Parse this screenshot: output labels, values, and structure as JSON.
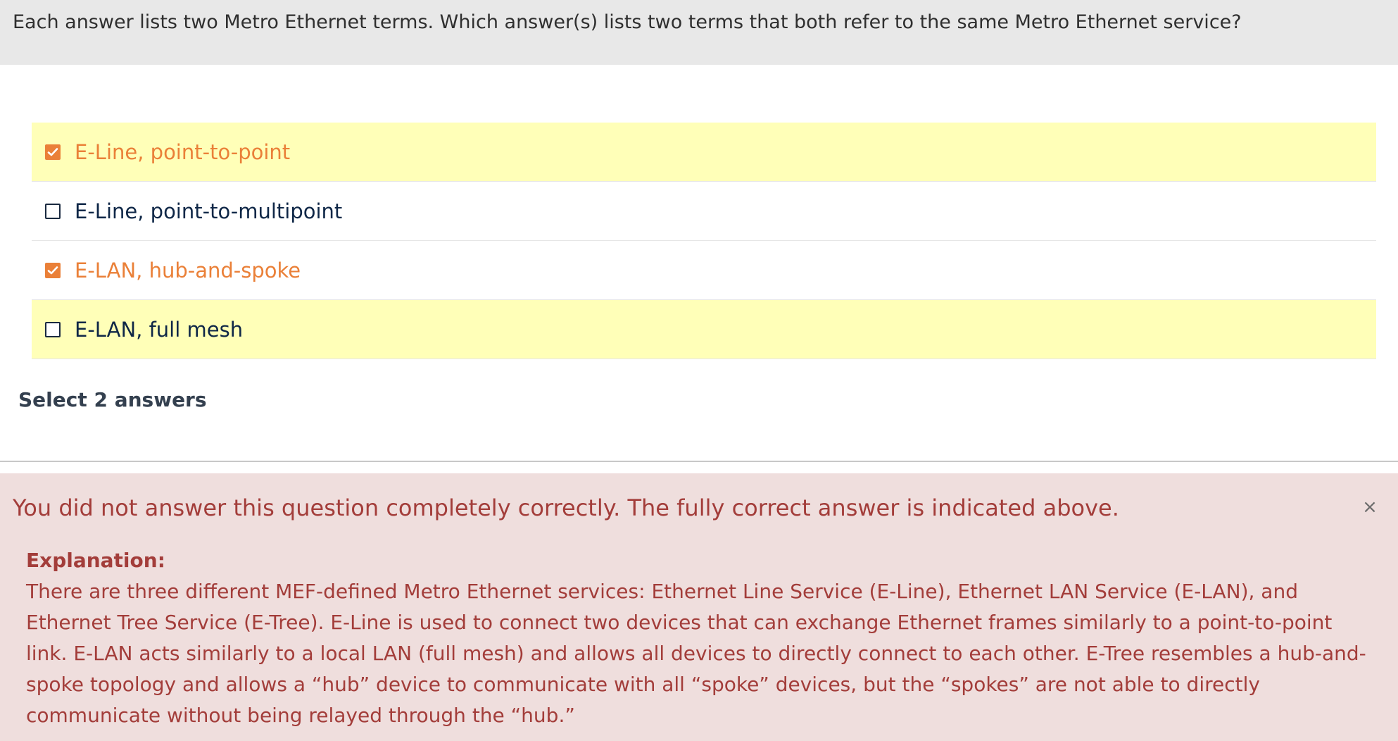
{
  "question": {
    "text": "Each answer lists two Metro Ethernet terms. Which answer(s) lists two terms that both refer to the same Metro Ethernet service?"
  },
  "answers": [
    {
      "label": "E-Line, point-to-point",
      "checked": true,
      "correct": true
    },
    {
      "label": "E-Line, point-to-multipoint",
      "checked": false,
      "correct": false
    },
    {
      "label": "E-LAN, hub-and-spoke",
      "checked": true,
      "correct": false
    },
    {
      "label": "E-LAN, full mesh",
      "checked": false,
      "correct": true
    }
  ],
  "hint": "Select 2 answers",
  "feedback": {
    "title": "You did not answer this question completely correctly. The fully correct answer is indicated above.",
    "close_glyph": "×",
    "explanation_heading": "Explanation:",
    "explanation_text": "There are three different MEF-defined Metro Ethernet services: Ethernet Line Service (E-Line), Ethernet LAN Service (E-LAN), and Ethernet Tree Service (E-Tree). E-Line is used to connect two devices that can exchange Ethernet frames similarly to a point-to-point link. E-LAN acts similarly to a local LAN (full mesh) and allows all devices to directly connect to each other. E-Tree resembles a hub-and-spoke topology and allows a “hub” device to communicate with all “spoke” devices, but the “spokes” are not able to directly communicate without being relayed through the “hub.”"
  },
  "colors": {
    "selected_text": "#ea8038",
    "correct_highlight": "#ffffb8",
    "feedback_bg": "#efdedd",
    "feedback_text": "#a33d3a"
  },
  "icons": {
    "checked": "checkbox-checked-icon",
    "unchecked": "checkbox-unchecked-icon",
    "close": "close-icon"
  }
}
